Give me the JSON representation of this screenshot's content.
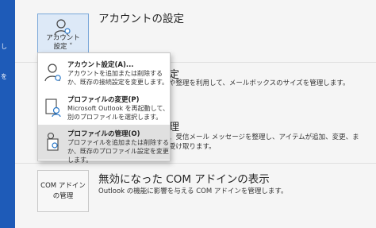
{
  "sidebar": {
    "fragment_1": "し",
    "fragment_2": "を"
  },
  "account_settings": {
    "tile_label_line1": "アカウント",
    "tile_label_line2": "設定 ˅",
    "title": "アカウントの設定"
  },
  "background_text": {
    "line1": "や整理を利用して、メールボックスのサイズを管理します。",
    "line2": "、受信メール メッセージを整理し、アイテムが追加、変更、ま",
    "line3": "受け取ります。"
  },
  "menu": {
    "items": [
      {
        "title": "アカウント設定(A)...",
        "desc": "アカウントを追加または削除するか、既存の接続設定を変更します。",
        "icon": "user-gear-icon"
      },
      {
        "title": "プロファイルの変更(P)",
        "desc": "Microsoft Outlook を再起動して、別のプロファイルを選択します。",
        "icon": "profile-switch-icon"
      },
      {
        "title": "プロファイルの管理(O)",
        "desc": "プロファイルを追加または削除するか、既存のプロファイル設定を変更します。",
        "icon": "profile-manage-icon"
      }
    ]
  },
  "com_addins": {
    "tile_label_line1": "COM アドイン",
    "tile_label_line2": "の管理",
    "title": "無効になった COM アドインの表示",
    "desc": "Outlook の機能に影響を与える COM アドインを管理します。"
  }
}
